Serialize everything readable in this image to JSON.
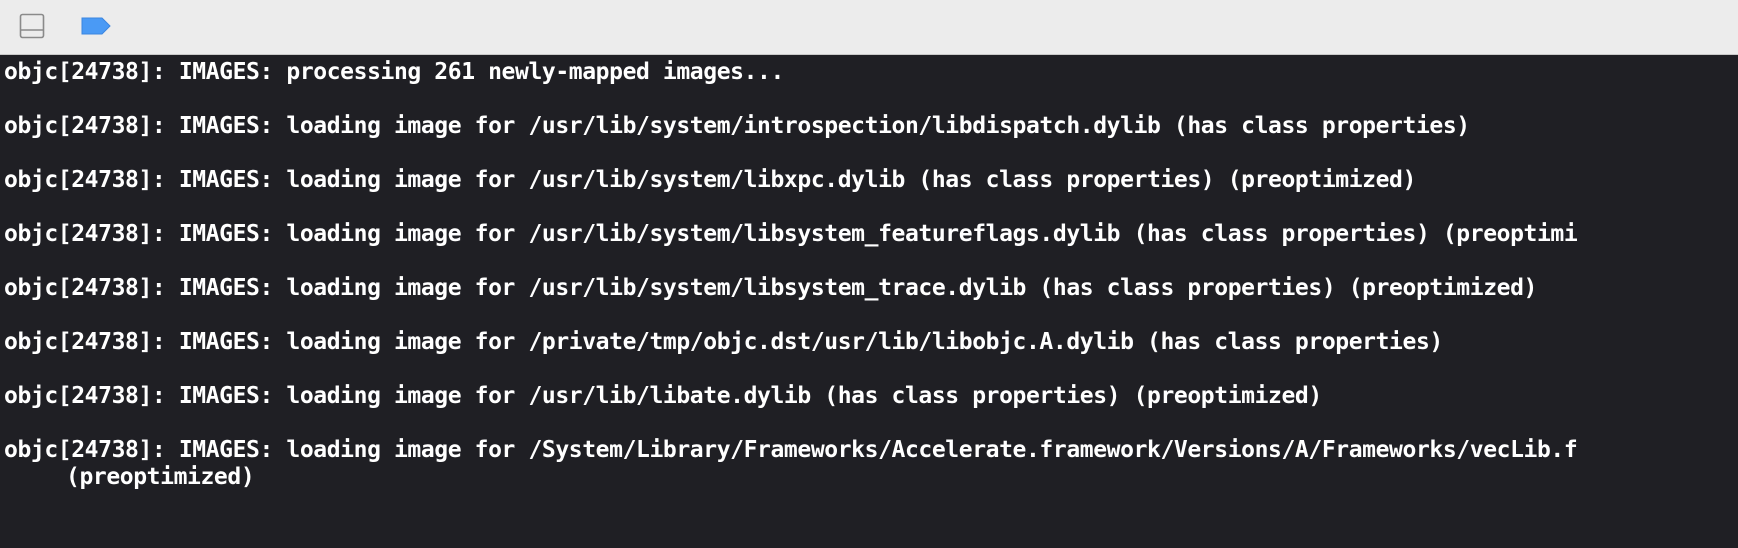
{
  "toolbar": {
    "panel_toggle_icon": "bottom-panel-toggle-icon",
    "breakpoint_icon": "breakpoint-icon",
    "breakpoint_color": "#4a9af5"
  },
  "console": {
    "lines": [
      "objc[24738]: IMAGES: processing 261 newly-mapped images...",
      "objc[24738]: IMAGES: loading image for /usr/lib/system/introspection/libdispatch.dylib (has class properties)",
      "objc[24738]: IMAGES: loading image for /usr/lib/system/libxpc.dylib (has class properties) (preoptimized)",
      "objc[24738]: IMAGES: loading image for /usr/lib/system/libsystem_featureflags.dylib (has class properties) (preoptimi",
      "objc[24738]: IMAGES: loading image for /usr/lib/system/libsystem_trace.dylib (has class properties) (preoptimized)",
      "objc[24738]: IMAGES: loading image for /private/tmp/objc.dst/usr/lib/libobjc.A.dylib (has class properties)",
      "objc[24738]: IMAGES: loading image for /usr/lib/libate.dylib (has class properties) (preoptimized)",
      "objc[24738]: IMAGES: loading image for /System/Library/Frameworks/Accelerate.framework/Versions/A/Frameworks/vecLib.f"
    ],
    "continuation": "(preoptimized)"
  }
}
